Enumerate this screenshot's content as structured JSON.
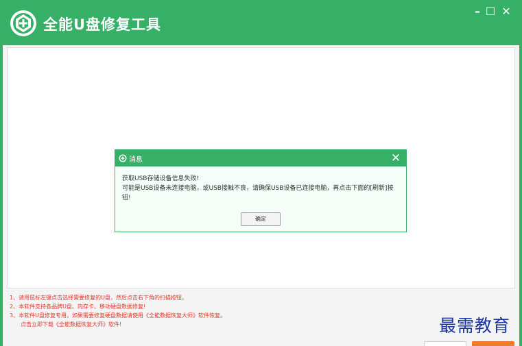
{
  "window": {
    "title": "全能U盘修复工具",
    "logo_icon": "usb-repair-logo-icon",
    "controls": {
      "minimize": "–",
      "maximize": "☐",
      "close": "✕"
    }
  },
  "notes": {
    "line1": "1、请用鼠标左键点击选择需要修复的U盘，然后点击右下角的扫描按钮。",
    "line2": "2、本软件支持各品牌U盘、内存卡、移动硬盘数据修复!",
    "line3": "3、本软件U盘修复专用，如果需要修复硬盘数据请使用《全能数据恢复大师》软件恢复。",
    "link": "点击立即下载《全能数据恢复大师》软件!"
  },
  "watermark": "最需教育",
  "dialog": {
    "title": "消息",
    "icon": "info-shield-icon",
    "close": "✕",
    "message_line1": "获取USB存储设备信息失败!",
    "message_line2": "可能是USB设备未连接电脑，或USB接触不良，请确保USB设备已连接电脑，再点击下面的[刷新]按钮!",
    "ok_label": "确定"
  },
  "colors": {
    "brand_green": "#37b067",
    "warning_red": "#e03a2c",
    "accent_orange": "#f07a2e",
    "watermark_blue": "#1a33a0"
  }
}
